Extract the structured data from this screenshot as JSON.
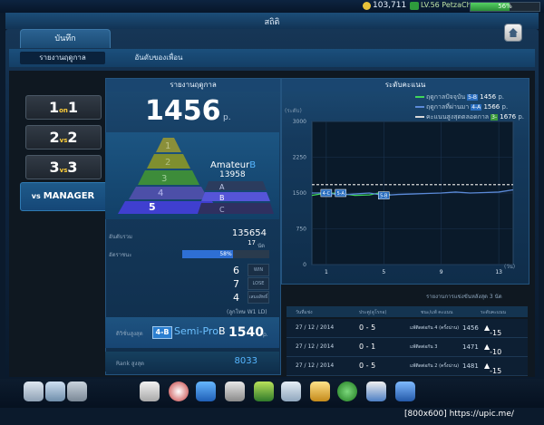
{
  "status": {
    "money": "103,711",
    "level": "LV.56",
    "player": "PetzaChelseaFC",
    "exp_percent": "56%",
    "exp_fraction": 0.56
  },
  "window_title": "สถิติ",
  "tab_main": "บันทึก",
  "subtabs": [
    "รายงานฤดูกาล",
    "อันดับของเพื่อน"
  ],
  "modes": [
    "1 on 1",
    "2 vs 2",
    "3 vs 3",
    "vs MANAGER"
  ],
  "mode_parts": [
    {
      "a": "1",
      "m": "on",
      "b": "1"
    },
    {
      "a": "2",
      "m": "vs",
      "b": "2"
    },
    {
      "a": "3",
      "m": "vs",
      "b": "3"
    },
    {
      "a": "vs",
      "m": "",
      "b": "MANAGER"
    }
  ],
  "left_panel": {
    "title": "รายงานฤดูกาล",
    "rating": "1456",
    "rating_unit": "p.",
    "tier_label": "Amateur",
    "tier_grade": "B",
    "tier_points": "13958",
    "pyramid_levels": [
      "1",
      "2",
      "3",
      "4",
      "5"
    ],
    "pyramid_grades": [
      "A",
      "B",
      "C"
    ],
    "rank_label": "อันดับรวม",
    "rank_value": "135654",
    "rank_extra": "17",
    "rank_extra_unit": "นัด",
    "winrate_label": "อัตราชนะ",
    "winrate_text": "58%",
    "winrate_fraction": 0.58,
    "wins": "6",
    "wins_label": "WIN",
    "losses": "7",
    "losses_label": "LOSE",
    "draws": "4",
    "draws_label": "เสมอสิทธิ์",
    "note": "(ลูกโทษ W1 LD)",
    "best_label": "ดิวิชั่นสูงสุด",
    "best_badge": "4-B",
    "best_name": "Semi-Pro",
    "best_grade": "B",
    "best_value": "1540",
    "best_unit": "p.",
    "best_rank_label": "Rank สูงสุด",
    "best_rank_value": "8033"
  },
  "chart_panel": {
    "title": "ระดับคะแนน",
    "legend": [
      {
        "label": "ฤดูกาลปัจจุบัน",
        "badge": "5-B",
        "value": "1456",
        "unit": "p.",
        "color": "#3fd65a"
      },
      {
        "label": "ฤดูกาลที่ผ่านมา",
        "badge": "4-A",
        "value": "1566",
        "unit": "p.",
        "color": "#5b8ad8"
      },
      {
        "label": "คะแนนสูงสุดตลอดกาล",
        "badge": "3-",
        "value": "1676",
        "unit": "p.",
        "color": "#d8d8d8"
      }
    ],
    "table_title": "รายงานการแข่งขันหลังสุด 3 นัด",
    "table_headers": [
      "วันที่แข่ง",
      "ประตู(ดูโรกอ)",
      "ชนะ/แพ้ คะแนน",
      "ระดับคะแนน"
    ],
    "rows": [
      {
        "date": "27 / 12 / 2014",
        "score": "0 - 5",
        "result": "แพ้ติดต่อกัน 4 (ครั้งน่าน)",
        "rating": "1456",
        "change": "-15"
      },
      {
        "date": "27 / 12 / 2014",
        "score": "0 - 1",
        "result": "แพ้ติดต่อกัน 3",
        "rating": "1471",
        "change": "-10"
      },
      {
        "date": "27 / 12 / 2014",
        "score": "0 - 5",
        "result": "แพ้ติดต่อกัน 2 (ครั้งน่าน)",
        "rating": "1481",
        "change": "-15"
      }
    ]
  },
  "chart_data": {
    "type": "line",
    "ylabel": "(ระดับ)",
    "xlabel": "(วัน)",
    "yticks": [
      "3000",
      "2250",
      "1500",
      "750",
      "0"
    ],
    "xticks": [
      "1",
      "5",
      "9",
      "13"
    ],
    "ylim": [
      0,
      3000
    ],
    "xlim": [
      0,
      14
    ],
    "series": [
      {
        "name": "ฤดูกาลปัจจุบัน",
        "color": "#3fd65a",
        "x": [
          0,
          1,
          2,
          3,
          4,
          5,
          5.5
        ],
        "y": [
          1450,
          1500,
          1490,
          1450,
          1460,
          1520,
          1456
        ]
      },
      {
        "name": "ฤดูกาลที่ผ่านมา",
        "color": "#5b8ad8",
        "x": [
          0,
          1,
          2,
          3,
          4,
          5,
          6,
          7,
          8,
          9,
          10,
          11,
          12,
          13,
          14
        ],
        "y": [
          1500,
          1500,
          1460,
          1480,
          1500,
          1450,
          1470,
          1480,
          1490,
          1500,
          1520,
          1500,
          1510,
          1520,
          1566
        ]
      },
      {
        "name": "คะแนนสูงสุดตลอดกาล",
        "color": "#d8d8d8",
        "dashed": true,
        "x": [
          0,
          14
        ],
        "y": [
          1676,
          1676
        ]
      }
    ],
    "markers": [
      {
        "x": 1,
        "y": 1500,
        "label": "4-C"
      },
      {
        "x": 2,
        "y": 1500,
        "label": "5-A"
      },
      {
        "x": 5,
        "y": 1450,
        "label": "5-B"
      }
    ]
  },
  "watermark": "[800x600] https://upic.me/"
}
